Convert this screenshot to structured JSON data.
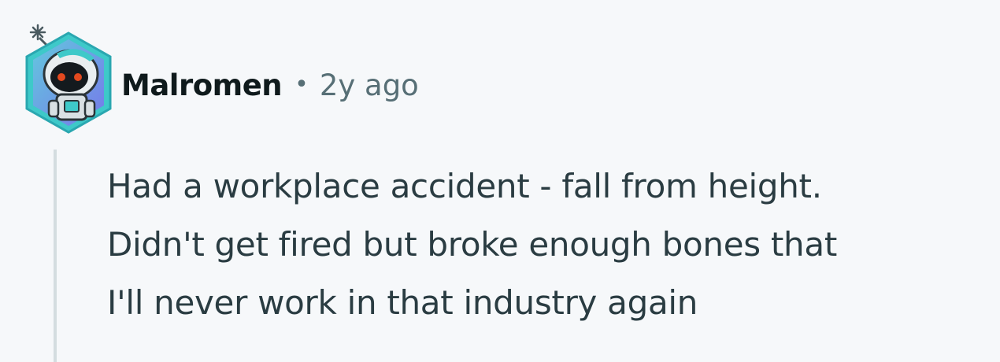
{
  "comment": {
    "author": "Malromen",
    "separator": "•",
    "timestamp": "2y ago",
    "avatar_icon": "robot-avatar-icon",
    "body_lines": [
      "Had a workplace accident - fall from height.",
      "Didn't get fired but broke enough bones that",
      "I'll never work in that industry again"
    ]
  },
  "colors": {
    "background": "#f6f8fa",
    "author": "#0f1a1c",
    "meta": "#576f76",
    "body_text": "#2a3c42",
    "thread_line": "#d4dde0",
    "avatar_hex": "#3ec9c9"
  }
}
